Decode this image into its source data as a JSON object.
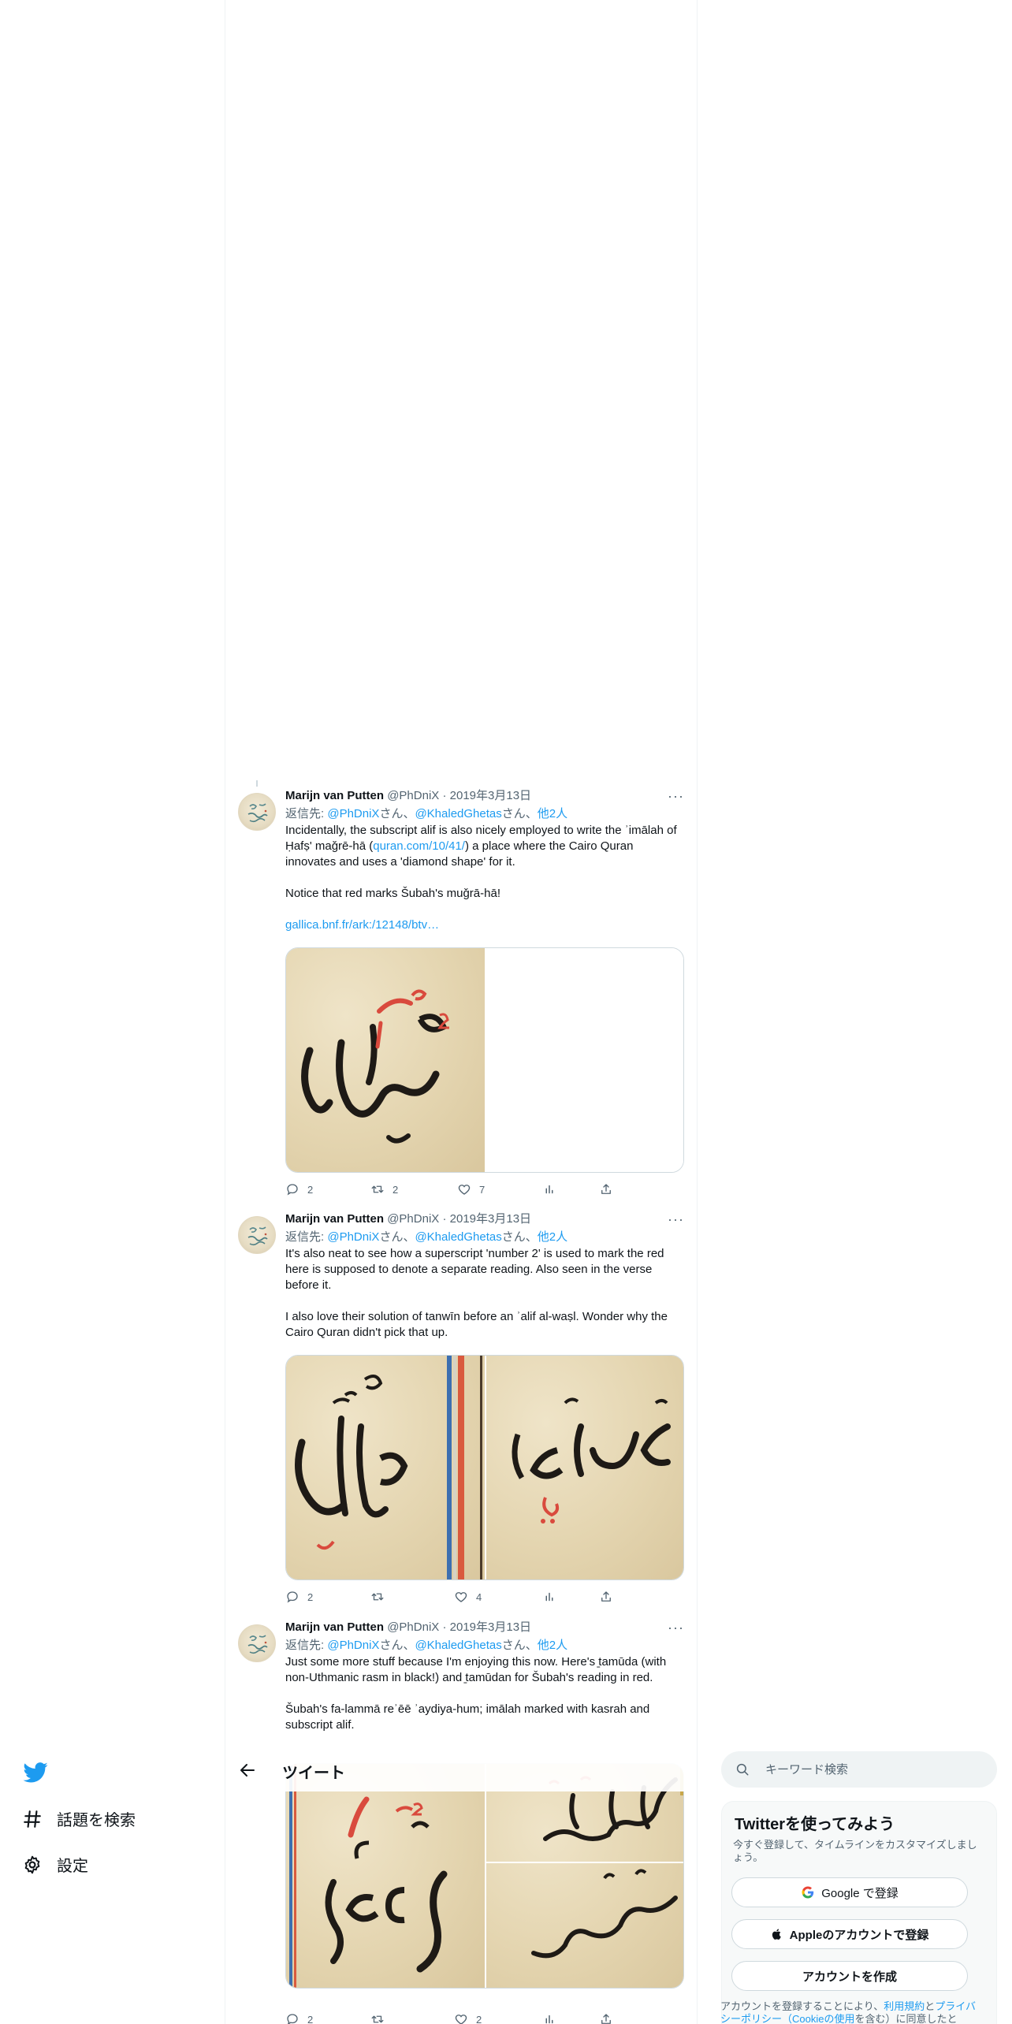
{
  "tweets": [
    {
      "name": "Marijn van Putten",
      "handle": "@PhDniX",
      "dot": "·",
      "date": "2019年3月13日",
      "more": "···",
      "reply": {
        "prefix": "返信先: ",
        "u1": "@PhDniX",
        "san1": "さん、",
        "u2": "@KhaledGhetas",
        "san2": "さん、",
        "others": "他2人"
      },
      "text": {
        "p1a": "Incidentally, the subscript alif is also nicely employed to write the ʾimālah of Ḥafṣ' maǧrē-hā (",
        "p1link": "quran.com/10/41/",
        "p1b": ") a place where the Cairo Quran innovates and uses a 'diamond shape' for it.",
        "p2": "Notice that red marks Šubah's muǧrā-hā!",
        "link": "gallica.bnf.fr/ark:/12148/btv…"
      },
      "actions": {
        "reply": "2",
        "retweet": "2",
        "like": "7"
      }
    },
    {
      "name": "Marijn van Putten",
      "handle": "@PhDniX",
      "dot": "·",
      "date": "2019年3月13日",
      "more": "···",
      "reply": {
        "prefix": "返信先: ",
        "u1": "@PhDniX",
        "san1": "さん、",
        "u2": "@KhaledGhetas",
        "san2": "さん、",
        "others": "他2人"
      },
      "text": {
        "p1": "It's also neat to see how a superscript 'number 2' is used to mark the red here is supposed to denote a separate reading. Also seen in the verse before it.",
        "p2": "I also love their solution of tanwīn before an ʾalif al-waṣl. Wonder why the Cairo Quran didn't pick that up."
      },
      "actions": {
        "reply": "2",
        "retweet": "",
        "like": "4"
      }
    },
    {
      "name": "Marijn van Putten",
      "handle": "@PhDniX",
      "dot": "·",
      "date": "2019年3月13日",
      "more": "···",
      "reply": {
        "prefix": "返信先: ",
        "u1": "@PhDniX",
        "san1": "さん、",
        "u2": "@KhaledGhetas",
        "san2": "さん、",
        "others": "他2人"
      },
      "text": {
        "p1": "Just some more stuff because I'm enjoying this now. Here's ̱tamūda (with non-Uthmanic rasm in black!) and ̱tamūdan for Šubah's reading in red.",
        "p2": "Šubah's fa-lammā reʾēē ʾaydiya-hum; imālah marked with kasrah and subscript alif."
      },
      "actions": {
        "reply": "2",
        "retweet": "",
        "like": "2"
      }
    }
  ],
  "nav": {
    "explore": "話題を検索",
    "settings": "設定"
  },
  "header": {
    "title": "ツイート"
  },
  "search": {
    "placeholder": "キーワード検索"
  },
  "signup": {
    "title": "Twitterを使ってみよう",
    "subtitle": "今すぐ登録して、タイムラインをカスタマイズしましょう。",
    "google": "Google で登録",
    "apple": "Appleのアカウントで登録",
    "create": "アカウントを作成"
  },
  "legal": {
    "pre": "アカウントを登録することにより、",
    "terms": "利用規約",
    "and": "と",
    "privacy": "プライバシーポリシー",
    "cookie": "（Cookieの使用",
    "post": "を含む）に同意したと"
  },
  "colors": {
    "accent": "#1d9bf0",
    "text": "#0f1419",
    "muted": "#536471",
    "ink_red": "#d94a3d"
  }
}
